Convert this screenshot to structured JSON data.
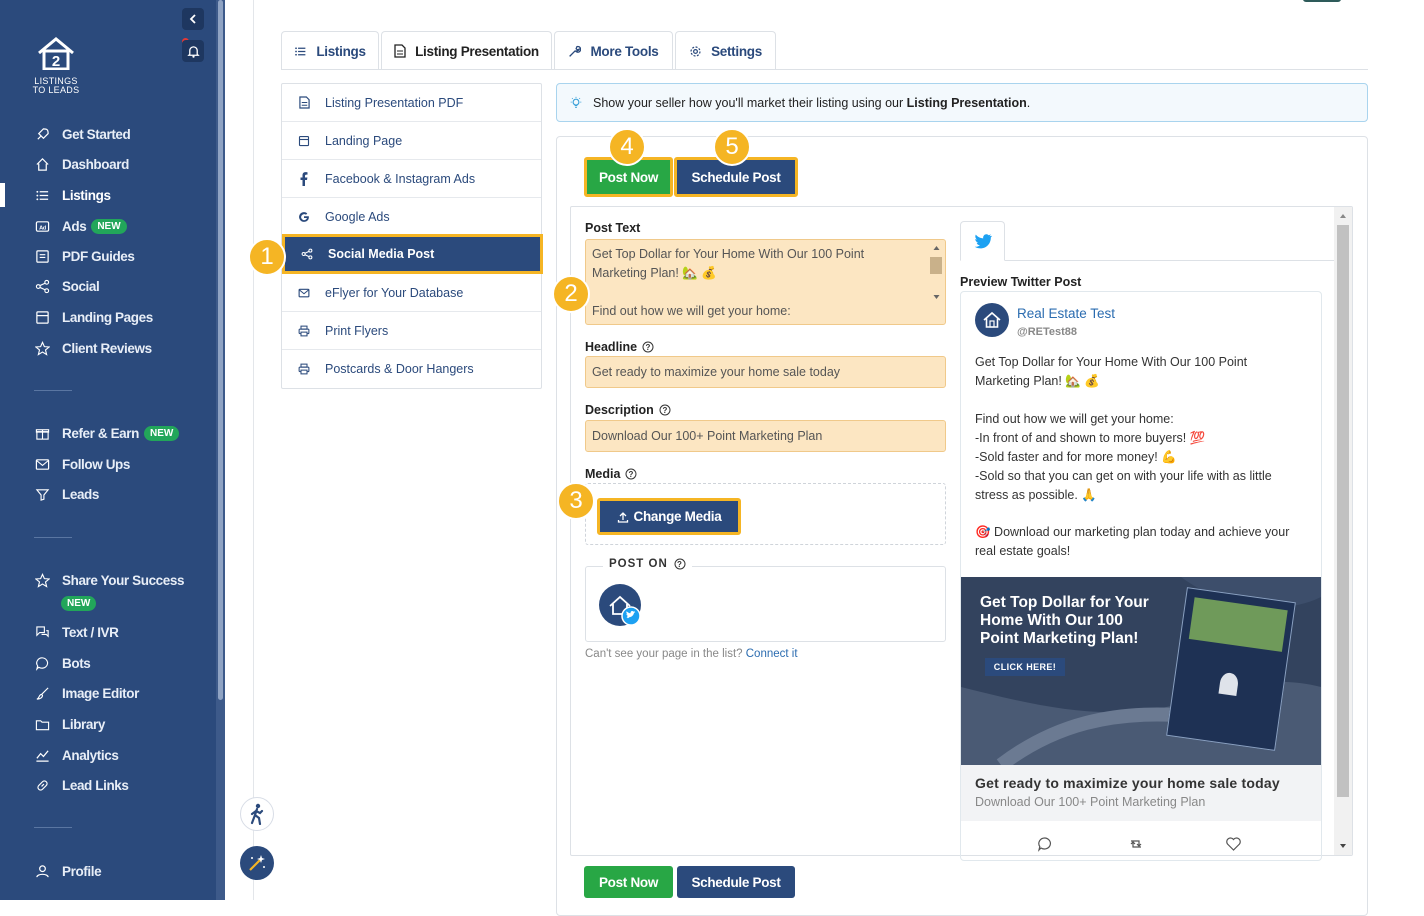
{
  "sidebar": {
    "logo_text_1": "LISTINGS",
    "logo_text_2": "TO LEADS",
    "items": [
      {
        "label": "Get Started",
        "icon": "rocket-icon"
      },
      {
        "label": "Dashboard",
        "icon": "home-icon"
      },
      {
        "label": "Listings",
        "icon": "list-icon"
      },
      {
        "label": "Ads",
        "icon": "ad-icon",
        "badge": "NEW"
      },
      {
        "label": "PDF Guides",
        "icon": "pdf-icon"
      },
      {
        "label": "Social",
        "icon": "share-icon"
      },
      {
        "label": "Landing Pages",
        "icon": "page-icon"
      },
      {
        "label": "Client Reviews",
        "icon": "star-icon"
      },
      {
        "label": "Refer & Earn",
        "icon": "gift-icon",
        "badge": "NEW"
      },
      {
        "label": "Follow Ups",
        "icon": "mail-icon"
      },
      {
        "label": "Leads",
        "icon": "filter-icon"
      },
      {
        "label": "Share Your Success",
        "icon": "star-icon",
        "badge": "NEW"
      },
      {
        "label": "Text / IVR",
        "icon": "text-icon"
      },
      {
        "label": "Bots",
        "icon": "chat-icon"
      },
      {
        "label": "Image Editor",
        "icon": "brush-icon"
      },
      {
        "label": "Library",
        "icon": "folder-icon"
      },
      {
        "label": "Analytics",
        "icon": "analytics-icon"
      },
      {
        "label": "Lead Links",
        "icon": "link-icon"
      },
      {
        "label": "Profile",
        "icon": "user-icon"
      }
    ]
  },
  "tabs": [
    {
      "label": "Listings",
      "icon": "list-icon"
    },
    {
      "label": "Listing Presentation",
      "icon": "document-icon"
    },
    {
      "label": "More Tools",
      "icon": "wrench-icon"
    },
    {
      "label": "Settings",
      "icon": "gear-icon"
    }
  ],
  "left_menu": [
    {
      "label": "Listing Presentation PDF",
      "icon": "document-icon"
    },
    {
      "label": "Landing Page",
      "icon": "page-icon"
    },
    {
      "label": "Facebook & Instagram Ads",
      "icon": "facebook-icon"
    },
    {
      "label": "Google Ads",
      "icon": "google-icon"
    },
    {
      "label": "Social Media Post",
      "icon": "share-icon"
    },
    {
      "label": "eFlyer for Your Database",
      "icon": "mail-icon"
    },
    {
      "label": "Print Flyers",
      "icon": "printer-icon"
    },
    {
      "label": "Postcards & Door Hangers",
      "icon": "printer-icon"
    }
  ],
  "info": {
    "text": "Show your seller how you'll market their listing using our ",
    "bold": "Listing Presentation",
    "end": "."
  },
  "actions": {
    "post_now": "Post Now",
    "schedule_post": "Schedule Post"
  },
  "steps": [
    "1",
    "2",
    "3",
    "4",
    "5"
  ],
  "form": {
    "post_text_label": "Post Text",
    "post_text_lines": [
      "Get Top Dollar for Your Home With Our 100 Point",
      "Marketing Plan! 🏡 💰",
      "",
      "Find out how we will get your home:"
    ],
    "headline_label": "Headline",
    "headline_value": "Get ready to maximize your home sale today",
    "description_label": "Description",
    "description_value": "Download Our 100+ Point Marketing Plan",
    "media_label": "Media",
    "change_media": "Change Media",
    "post_on_label": "POST ON",
    "cant_see": "Can't see your page in the list?",
    "connect_it": "Connect it"
  },
  "preview": {
    "label": "Preview Twitter Post",
    "name": "Real Estate Test",
    "handle": "@RETest88",
    "lines": [
      "Get Top Dollar for Your Home With Our 100 Point",
      "Marketing Plan! 🏡 💰",
      "",
      "Find out how we will get your home:",
      "-In front of and shown to more buyers! 💯",
      "-Sold faster and for more money! 💪",
      "-Sold so that you can get on with your life with as little",
      "stress as possible. 🙏",
      "",
      "🎯 Download our marketing plan today and achieve your",
      "real estate goals!"
    ],
    "image_title": "Get Top Dollar for Your Home With Our 100 Point Marketing Plan!",
    "image_cta": "CLICK HERE!",
    "card_headline": "Get ready to maximize your home sale today",
    "card_description": "Download Our 100+ Point Marketing Plan"
  },
  "colors": {
    "sidebar": "#2b4a7c",
    "accent_blue": "#2b4a7c",
    "green": "#28a745",
    "highlight": "#f5b524",
    "field_bg": "#fce6c2"
  }
}
